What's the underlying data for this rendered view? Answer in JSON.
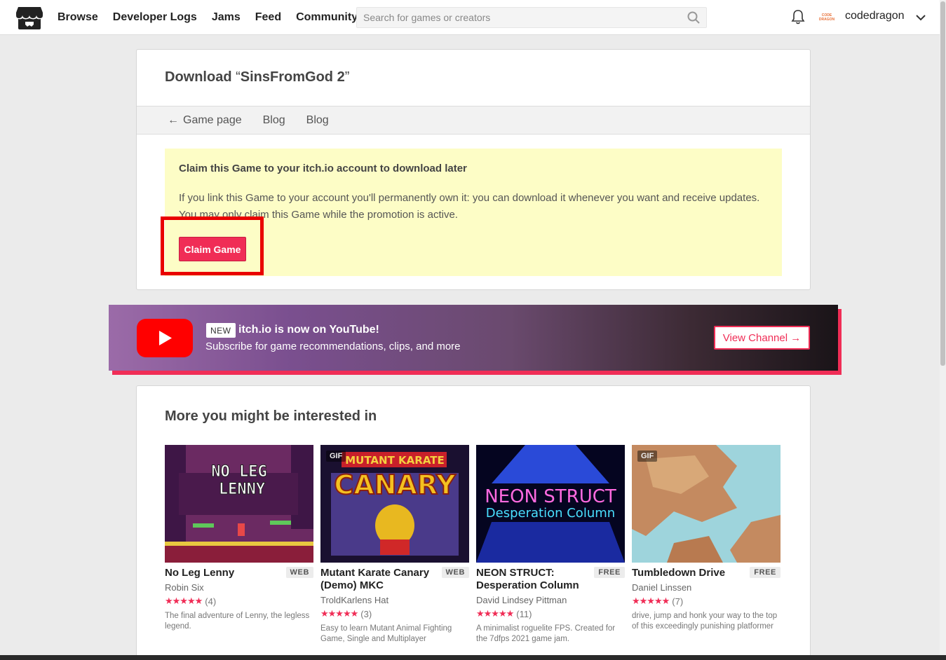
{
  "header": {
    "nav": [
      "Browse",
      "Developer Logs",
      "Jams",
      "Feed",
      "Community"
    ],
    "search_placeholder": "Search for games or creators",
    "avatar_text": [
      "CODE",
      "DRAGON"
    ],
    "username": "codedragon"
  },
  "download": {
    "title_prefix": "Download ",
    "open_quote": "“",
    "game_name": "SinsFromGod 2",
    "close_quote": "”",
    "tabs": [
      {
        "label": "Game page",
        "icon": "arrow-left-icon"
      },
      {
        "label": "Blog"
      },
      {
        "label": "Blog"
      }
    ],
    "claim": {
      "title": "Claim this Game to your itch.io account to download later",
      "text": "If you link this Game to your account you'll permanently own it: you can download it whenever you want and receive updates. You may only claim this Game while the promotion is active.",
      "button": "Claim Game"
    }
  },
  "youtube": {
    "badge": "NEW",
    "title": "itch.io is now on YouTube!",
    "subtitle": "Subscribe for game recommendations, clips, and more",
    "button": "View Channel →"
  },
  "more": {
    "heading": "More you might be interested in",
    "games": [
      {
        "title": "No Leg Lenny",
        "badge": "WEB",
        "author": "Robin Six",
        "stars": "★★★★★",
        "count": "(4)",
        "desc": "The final adventure of Lenny, the legless legend.",
        "gif": ""
      },
      {
        "title": "Mutant Karate Canary (Demo) MKC",
        "badge": "WEB",
        "author": "TroldKarlens Hat",
        "stars": "★★★★★",
        "count": "(3)",
        "desc": "Easy to learn Mutant Animal Fighting Game, Single and Multiplayer",
        "gif": "GIF"
      },
      {
        "title": "NEON STRUCT: Desperation Column",
        "badge": "FREE",
        "author": "David Lindsey Pittman",
        "stars": "★★★★★",
        "count": "(11)",
        "desc": "A minimalist roguelite FPS. Created for the 7dfps 2021 game jam.",
        "gif": ""
      },
      {
        "title": "Tumbledown Drive",
        "badge": "FREE",
        "author": "Daniel Linssen",
        "stars": "★★★★★",
        "count": "(7)",
        "desc": "drive, jump and honk your way to the top of this exceedingly punishing platformer",
        "gif": "GIF"
      }
    ],
    "thumb_text": {
      "lenny": [
        "NO LEG",
        "LENNY"
      ],
      "canary": [
        "MUTANT KARATE",
        "CANARY"
      ],
      "neon": [
        "NEON STRUCT",
        "Desperation Column"
      ]
    }
  },
  "colors": {
    "accent": "#f02d56",
    "claim_bg": "#fdfdc6",
    "highlight": "#e90000"
  }
}
